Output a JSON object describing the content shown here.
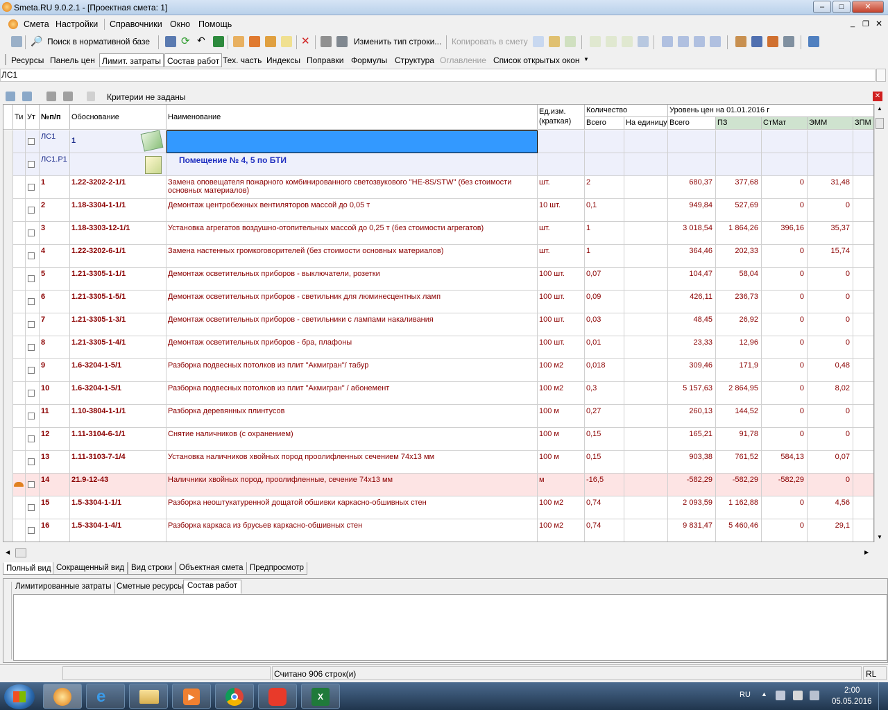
{
  "window": {
    "title": "Smeta.RU  9.0.2.1   - [Проектная смета: 1]",
    "min": "–",
    "max": "□",
    "close": "✕"
  },
  "menu": [
    "Смета",
    "Настройки",
    "Справочники",
    "Окно",
    "Помощь"
  ],
  "toolbar": {
    "search_label": "Поиск в нормативной базе",
    "change_row_type": "Изменить тип строки...",
    "copy_to_estimate": "Копировать в смету"
  },
  "top_tabs": [
    "Ресурсы",
    "Панель цен",
    "Лимит. затраты",
    "Состав работ",
    "Тех. часть",
    "Индексы",
    "Поправки",
    "Формулы",
    "Структура",
    "Оглавление",
    "Список открытых окон"
  ],
  "address": "ЛС1",
  "filter": {
    "text": "Критерии не заданы"
  },
  "columns": {
    "ti": "Ти",
    "ut": "Ут",
    "num": "№п/п",
    "basis": "Обоснование",
    "name": "Наименование",
    "unit": "Ед.изм. (краткая)",
    "unit1": "Ед.изм.",
    "unit2": "(краткая)",
    "qty": "Количество",
    "qty_total": "Всего",
    "qty_unit": "На единицу",
    "price_level": "Уровень цен на 01.01.2016 г",
    "total": "Всего",
    "pz": "ПЗ",
    "stmat": "СтМат",
    "emm": "ЭММ",
    "zpm": "ЗПМ"
  },
  "header_rows": [
    {
      "code": "ЛС1",
      "num": "1",
      "name": ""
    },
    {
      "code": "ЛС1.Р1",
      "num": "",
      "name": "Помещение № 4, 5 по БТИ"
    }
  ],
  "rows": [
    {
      "num": "1",
      "basis": "1.22-3202-2-1/1",
      "name": "Замена оповещателя пожарного комбинированного светозвукового \"НЕ-8S/STW\" (без стоимости",
      "name2": "основных материалов)",
      "unit": "шт.",
      "qty": "2",
      "total": "680,37",
      "pz": "377,68",
      "stmat": "0",
      "emm": "31,48"
    },
    {
      "num": "2",
      "basis": "1.18-3304-1-1/1",
      "name": "Демонтаж центробежных вентиляторов массой до 0,05 т",
      "name2": "",
      "unit": "10 шт.",
      "qty": "0,1",
      "total": "949,84",
      "pz": "527,69",
      "stmat": "0",
      "emm": "0"
    },
    {
      "num": "3",
      "basis": "1.18-3303-12-1/1",
      "name": "Установка агрегатов воздушно-отопительных массой до 0,25 т (без стоимости агрегатов)",
      "name2": "",
      "unit": "шт.",
      "qty": "1",
      "total": "3 018,54",
      "pz": "1 864,26",
      "stmat": "396,16",
      "emm": "35,37"
    },
    {
      "num": "4",
      "basis": "1.22-3202-6-1/1",
      "name": "Замена настенных громкоговорителей (без стоимости основных материалов)",
      "name2": "",
      "unit": "шт.",
      "qty": "1",
      "total": "364,46",
      "pz": "202,33",
      "stmat": "0",
      "emm": "15,74"
    },
    {
      "num": "5",
      "basis": "1.21-3305-1-1/1",
      "name": "Демонтаж осветительных приборов - выключатели, розетки",
      "name2": "",
      "unit": "100 шт.",
      "qty": "0,07",
      "total": "104,47",
      "pz": "58,04",
      "stmat": "0",
      "emm": "0"
    },
    {
      "num": "6",
      "basis": "1.21-3305-1-5/1",
      "name": "Демонтаж осветительных приборов - светильник для люминесцентных ламп",
      "name2": "",
      "unit": "100 шт.",
      "qty": "0,09",
      "total": "426,11",
      "pz": "236,73",
      "stmat": "0",
      "emm": "0"
    },
    {
      "num": "7",
      "basis": "1.21-3305-1-3/1",
      "name": "Демонтаж осветительных приборов - светильники с лампами накаливания",
      "name2": "",
      "unit": "100 шт.",
      "qty": "0,03",
      "total": "48,45",
      "pz": "26,92",
      "stmat": "0",
      "emm": "0"
    },
    {
      "num": "8",
      "basis": "1.21-3305-1-4/1",
      "name": "Демонтаж осветительных приборов - бра, плафоны",
      "name2": "",
      "unit": "100 шт.",
      "qty": "0,01",
      "total": "23,33",
      "pz": "12,96",
      "stmat": "0",
      "emm": "0"
    },
    {
      "num": "9",
      "basis": "1.6-3204-1-5/1",
      "name": "Разборка подвесных потолков из плит \"Акмигран\"/ табур",
      "name2": "",
      "unit": "100 м2",
      "qty": "0,018",
      "total": "309,46",
      "pz": "171,9",
      "stmat": "0",
      "emm": "0,48"
    },
    {
      "num": "10",
      "basis": "1.6-3204-1-5/1",
      "name": "Разборка подвесных потолков из плит \"Акмигран\" / абонемент",
      "name2": "",
      "unit": "100 м2",
      "qty": "0,3",
      "total": "5 157,63",
      "pz": "2 864,95",
      "stmat": "0",
      "emm": "8,02"
    },
    {
      "num": "11",
      "basis": "1.10-3804-1-1/1",
      "name": "Разборка деревянных плинтусов",
      "name2": "",
      "unit": "100 м",
      "qty": "0,27",
      "total": "260,13",
      "pz": "144,52",
      "stmat": "0",
      "emm": "0"
    },
    {
      "num": "12",
      "basis": "1.11-3104-6-1/1",
      "name": "Снятие наличников (с охранением)",
      "name2": "",
      "unit": "100 м",
      "qty": "0,15",
      "total": "165,21",
      "pz": "91,78",
      "stmat": "0",
      "emm": "0"
    },
    {
      "num": "13",
      "basis": "1.11-3103-7-1/4",
      "name": "Установка наличников хвойных пород проолифленных сечением 74х13 мм",
      "name2": "",
      "unit": "100 м",
      "qty": "0,15",
      "total": "903,38",
      "pz": "761,52",
      "stmat": "584,13",
      "emm": "0,07"
    },
    {
      "num": "14",
      "basis": "21.9-12-43",
      "name": "Наличники хвойных пород, проолифленные, сечение 74х13 мм",
      "name2": "",
      "unit": "м",
      "qty": "-16,5",
      "total": "-582,29",
      "pz": "-582,29",
      "stmat": "-582,29",
      "emm": "0"
    },
    {
      "num": "15",
      "basis": "1.5-3304-1-1/1",
      "name": "Разборка неоштукатуренной дощатой обшивки каркасно-обшивных стен",
      "name2": "",
      "unit": "100 м2",
      "qty": "0,74",
      "total": "2 093,59",
      "pz": "1 162,88",
      "stmat": "0",
      "emm": "4,56"
    },
    {
      "num": "16",
      "basis": "1.5-3304-1-4/1",
      "name": "Разборка каркаса из брусьев каркасно-обшивных стен",
      "name2": "",
      "unit": "100 м2",
      "qty": "0,74",
      "total": "9 831,47",
      "pz": "5 460,46",
      "stmat": "0",
      "emm": "29,1"
    }
  ],
  "view_tabs": [
    "Полный вид",
    "Сокращенный вид",
    "Вид строки",
    "Объектная смета",
    "Предпросмотр"
  ],
  "detail_tabs": [
    "Лимитированные затраты",
    "Сметные ресурсы",
    "Состав работ"
  ],
  "status": {
    "rows": "Считано 906 строк(и)",
    "lang": "RL"
  },
  "taskbar": {
    "lang": "RU",
    "time": "2:00",
    "date": "05.05.2016"
  },
  "colors": {
    "selected": "#3399ff",
    "highlight_row": "#fde4e4",
    "section_bg": "#eef0fb",
    "red_text": "#8b0000"
  }
}
